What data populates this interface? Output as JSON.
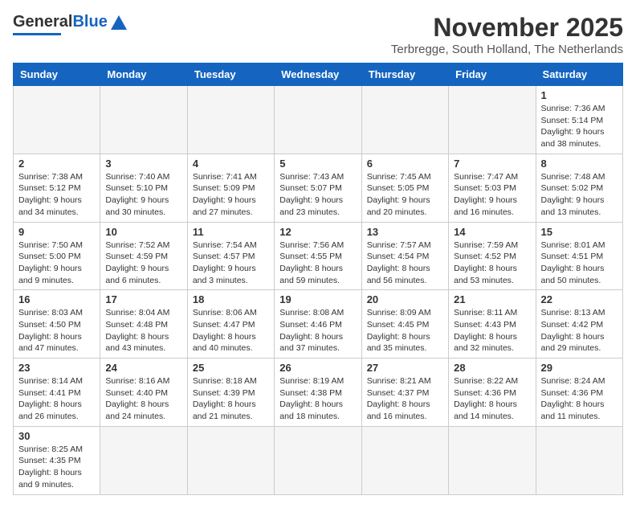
{
  "header": {
    "logo_general": "General",
    "logo_blue": "Blue",
    "month_title": "November 2025",
    "location": "Terbregge, South Holland, The Netherlands"
  },
  "weekdays": [
    "Sunday",
    "Monday",
    "Tuesday",
    "Wednesday",
    "Thursday",
    "Friday",
    "Saturday"
  ],
  "weeks": [
    [
      {
        "day": "",
        "info": ""
      },
      {
        "day": "",
        "info": ""
      },
      {
        "day": "",
        "info": ""
      },
      {
        "day": "",
        "info": ""
      },
      {
        "day": "",
        "info": ""
      },
      {
        "day": "",
        "info": ""
      },
      {
        "day": "1",
        "info": "Sunrise: 7:36 AM\nSunset: 5:14 PM\nDaylight: 9 hours and 38 minutes."
      }
    ],
    [
      {
        "day": "2",
        "info": "Sunrise: 7:38 AM\nSunset: 5:12 PM\nDaylight: 9 hours and 34 minutes."
      },
      {
        "day": "3",
        "info": "Sunrise: 7:40 AM\nSunset: 5:10 PM\nDaylight: 9 hours and 30 minutes."
      },
      {
        "day": "4",
        "info": "Sunrise: 7:41 AM\nSunset: 5:09 PM\nDaylight: 9 hours and 27 minutes."
      },
      {
        "day": "5",
        "info": "Sunrise: 7:43 AM\nSunset: 5:07 PM\nDaylight: 9 hours and 23 minutes."
      },
      {
        "day": "6",
        "info": "Sunrise: 7:45 AM\nSunset: 5:05 PM\nDaylight: 9 hours and 20 minutes."
      },
      {
        "day": "7",
        "info": "Sunrise: 7:47 AM\nSunset: 5:03 PM\nDaylight: 9 hours and 16 minutes."
      },
      {
        "day": "8",
        "info": "Sunrise: 7:48 AM\nSunset: 5:02 PM\nDaylight: 9 hours and 13 minutes."
      }
    ],
    [
      {
        "day": "9",
        "info": "Sunrise: 7:50 AM\nSunset: 5:00 PM\nDaylight: 9 hours and 9 minutes."
      },
      {
        "day": "10",
        "info": "Sunrise: 7:52 AM\nSunset: 4:59 PM\nDaylight: 9 hours and 6 minutes."
      },
      {
        "day": "11",
        "info": "Sunrise: 7:54 AM\nSunset: 4:57 PM\nDaylight: 9 hours and 3 minutes."
      },
      {
        "day": "12",
        "info": "Sunrise: 7:56 AM\nSunset: 4:55 PM\nDaylight: 8 hours and 59 minutes."
      },
      {
        "day": "13",
        "info": "Sunrise: 7:57 AM\nSunset: 4:54 PM\nDaylight: 8 hours and 56 minutes."
      },
      {
        "day": "14",
        "info": "Sunrise: 7:59 AM\nSunset: 4:52 PM\nDaylight: 8 hours and 53 minutes."
      },
      {
        "day": "15",
        "info": "Sunrise: 8:01 AM\nSunset: 4:51 PM\nDaylight: 8 hours and 50 minutes."
      }
    ],
    [
      {
        "day": "16",
        "info": "Sunrise: 8:03 AM\nSunset: 4:50 PM\nDaylight: 8 hours and 47 minutes."
      },
      {
        "day": "17",
        "info": "Sunrise: 8:04 AM\nSunset: 4:48 PM\nDaylight: 8 hours and 43 minutes."
      },
      {
        "day": "18",
        "info": "Sunrise: 8:06 AM\nSunset: 4:47 PM\nDaylight: 8 hours and 40 minutes."
      },
      {
        "day": "19",
        "info": "Sunrise: 8:08 AM\nSunset: 4:46 PM\nDaylight: 8 hours and 37 minutes."
      },
      {
        "day": "20",
        "info": "Sunrise: 8:09 AM\nSunset: 4:45 PM\nDaylight: 8 hours and 35 minutes."
      },
      {
        "day": "21",
        "info": "Sunrise: 8:11 AM\nSunset: 4:43 PM\nDaylight: 8 hours and 32 minutes."
      },
      {
        "day": "22",
        "info": "Sunrise: 8:13 AM\nSunset: 4:42 PM\nDaylight: 8 hours and 29 minutes."
      }
    ],
    [
      {
        "day": "23",
        "info": "Sunrise: 8:14 AM\nSunset: 4:41 PM\nDaylight: 8 hours and 26 minutes."
      },
      {
        "day": "24",
        "info": "Sunrise: 8:16 AM\nSunset: 4:40 PM\nDaylight: 8 hours and 24 minutes."
      },
      {
        "day": "25",
        "info": "Sunrise: 8:18 AM\nSunset: 4:39 PM\nDaylight: 8 hours and 21 minutes."
      },
      {
        "day": "26",
        "info": "Sunrise: 8:19 AM\nSunset: 4:38 PM\nDaylight: 8 hours and 18 minutes."
      },
      {
        "day": "27",
        "info": "Sunrise: 8:21 AM\nSunset: 4:37 PM\nDaylight: 8 hours and 16 minutes."
      },
      {
        "day": "28",
        "info": "Sunrise: 8:22 AM\nSunset: 4:36 PM\nDaylight: 8 hours and 14 minutes."
      },
      {
        "day": "29",
        "info": "Sunrise: 8:24 AM\nSunset: 4:36 PM\nDaylight: 8 hours and 11 minutes."
      }
    ],
    [
      {
        "day": "30",
        "info": "Sunrise: 8:25 AM\nSunset: 4:35 PM\nDaylight: 8 hours and 9 minutes."
      },
      {
        "day": "",
        "info": ""
      },
      {
        "day": "",
        "info": ""
      },
      {
        "day": "",
        "info": ""
      },
      {
        "day": "",
        "info": ""
      },
      {
        "day": "",
        "info": ""
      },
      {
        "day": "",
        "info": ""
      }
    ]
  ]
}
